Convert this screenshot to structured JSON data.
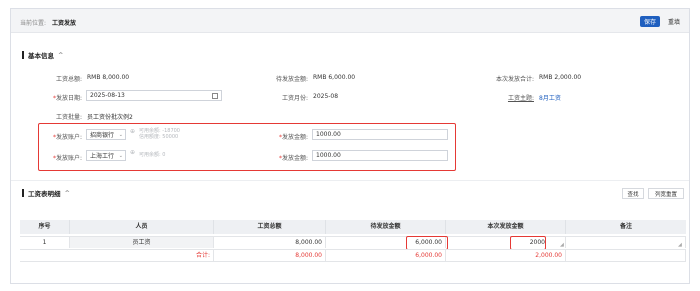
{
  "header": {
    "breadcrumb_prefix": "当前位置:",
    "breadcrumb_current": "工资发放",
    "save_label": "保存",
    "return_label": "重填"
  },
  "basic": {
    "title": "基本信息",
    "chevron": "^",
    "total_label": "工资总额:",
    "total_value": "RMB 8,000.00",
    "pending_label": "待发放金额:",
    "pending_value": "RMB 6,000.00",
    "current_label": "本次发放合计:",
    "current_value": "RMB 2,000.00",
    "date_label": "发放日期:",
    "date_value": "2025-08-13",
    "month_label": "工资月份:",
    "month_value": "2025-08",
    "subject_label": "工资主题:",
    "subject_value": "8月工资",
    "batch_label": "工资批量:",
    "batch_value": "员工资份批次例2",
    "accounts": [
      {
        "account_label": "发放账户:",
        "account_value": "招商银行",
        "hint1": "可用余额: -18700",
        "hint2": "信用额度: 50000",
        "amount_label": "发放金额:",
        "amount_value": "1000.00"
      },
      {
        "account_label": "发放账户:",
        "account_value": "上海工行",
        "hint1": "可用余额: 0",
        "hint2": "",
        "amount_label": "发放金额:",
        "amount_value": "1000.00"
      }
    ]
  },
  "detail": {
    "title": "工资表明细",
    "chevron": "^",
    "query_label": "查找",
    "reset_label": "列宽重置",
    "columns": [
      "序号",
      "人员",
      "工资总额",
      "待发放金额",
      "本次发放金额",
      "备注"
    ],
    "rows": [
      {
        "index": "1",
        "person": "员工资",
        "total": "8,000.00",
        "pending": "6,000.00",
        "current": "2000",
        "note": ""
      }
    ],
    "sum_label": "合计:",
    "sum_total": "8,000.00",
    "sum_pending": "6,000.00",
    "sum_current": "2,000.00"
  },
  "colors": {
    "primary": "#1f5fbf",
    "highlight": "#e53935"
  }
}
